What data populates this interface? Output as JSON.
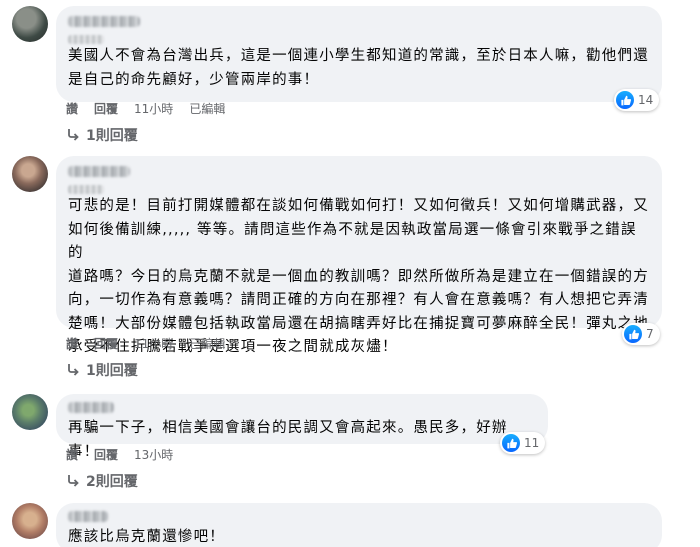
{
  "comments": [
    {
      "text": "美國人不會為台灣出兵，這是一個連小學生都知道的常識，至於日本人嘛，勸他們還\n是自己的命先顧好，少管兩岸的事！",
      "reaction_count": "14",
      "actions": {
        "like": "讚",
        "reply": "回覆",
        "time": "11小時",
        "edited": "已編輯"
      },
      "replies_label": "1則回覆"
    },
    {
      "text": "可悲的是！目前打開媒體都在談如何備戰如何打！又如何徵兵！又如何增購武器，又\n如何後備訓練,,,,, 等等。請問這些作為不就是因執政當局選一條會引來戰爭之錯誤的\n道路嗎？今日的烏克蘭不就是一個血的教訓嗎？即然所做所為是建立在一個錯誤的方\n向，一切作為有意義嗎？請問正確的方向在那裡？有人會在意義嗎？有人想把它弄清\n楚嗎！大部份媒體包括執政當局還在胡搞瞎弄好比在捕捉寶可夢麻醉全民！彈丸之地\n承受不住折騰若戰爭是選項一夜之間就成灰燼！",
      "reaction_count": "7",
      "actions": {
        "like": "讚",
        "reply": "回覆",
        "time": "11小時",
        "edited": "已編輯"
      },
      "replies_label": "1則回覆"
    },
    {
      "text": "再騙一下子，相信美國會讓台的民調又會高起來。愚民多，好辦事！",
      "reaction_count": "11",
      "actions": {
        "like": "讚",
        "reply": "回覆",
        "time": "13小時"
      },
      "replies_label": "2則回覆"
    },
    {
      "text": "應該比烏克蘭還慘吧！"
    }
  ],
  "colors": {
    "accent": "#0866ff",
    "bubble": "#f0f2f5",
    "muted": "#65676b"
  },
  "icons": {
    "reaction": "like-icon",
    "replies": "reply-arrow-icon"
  }
}
